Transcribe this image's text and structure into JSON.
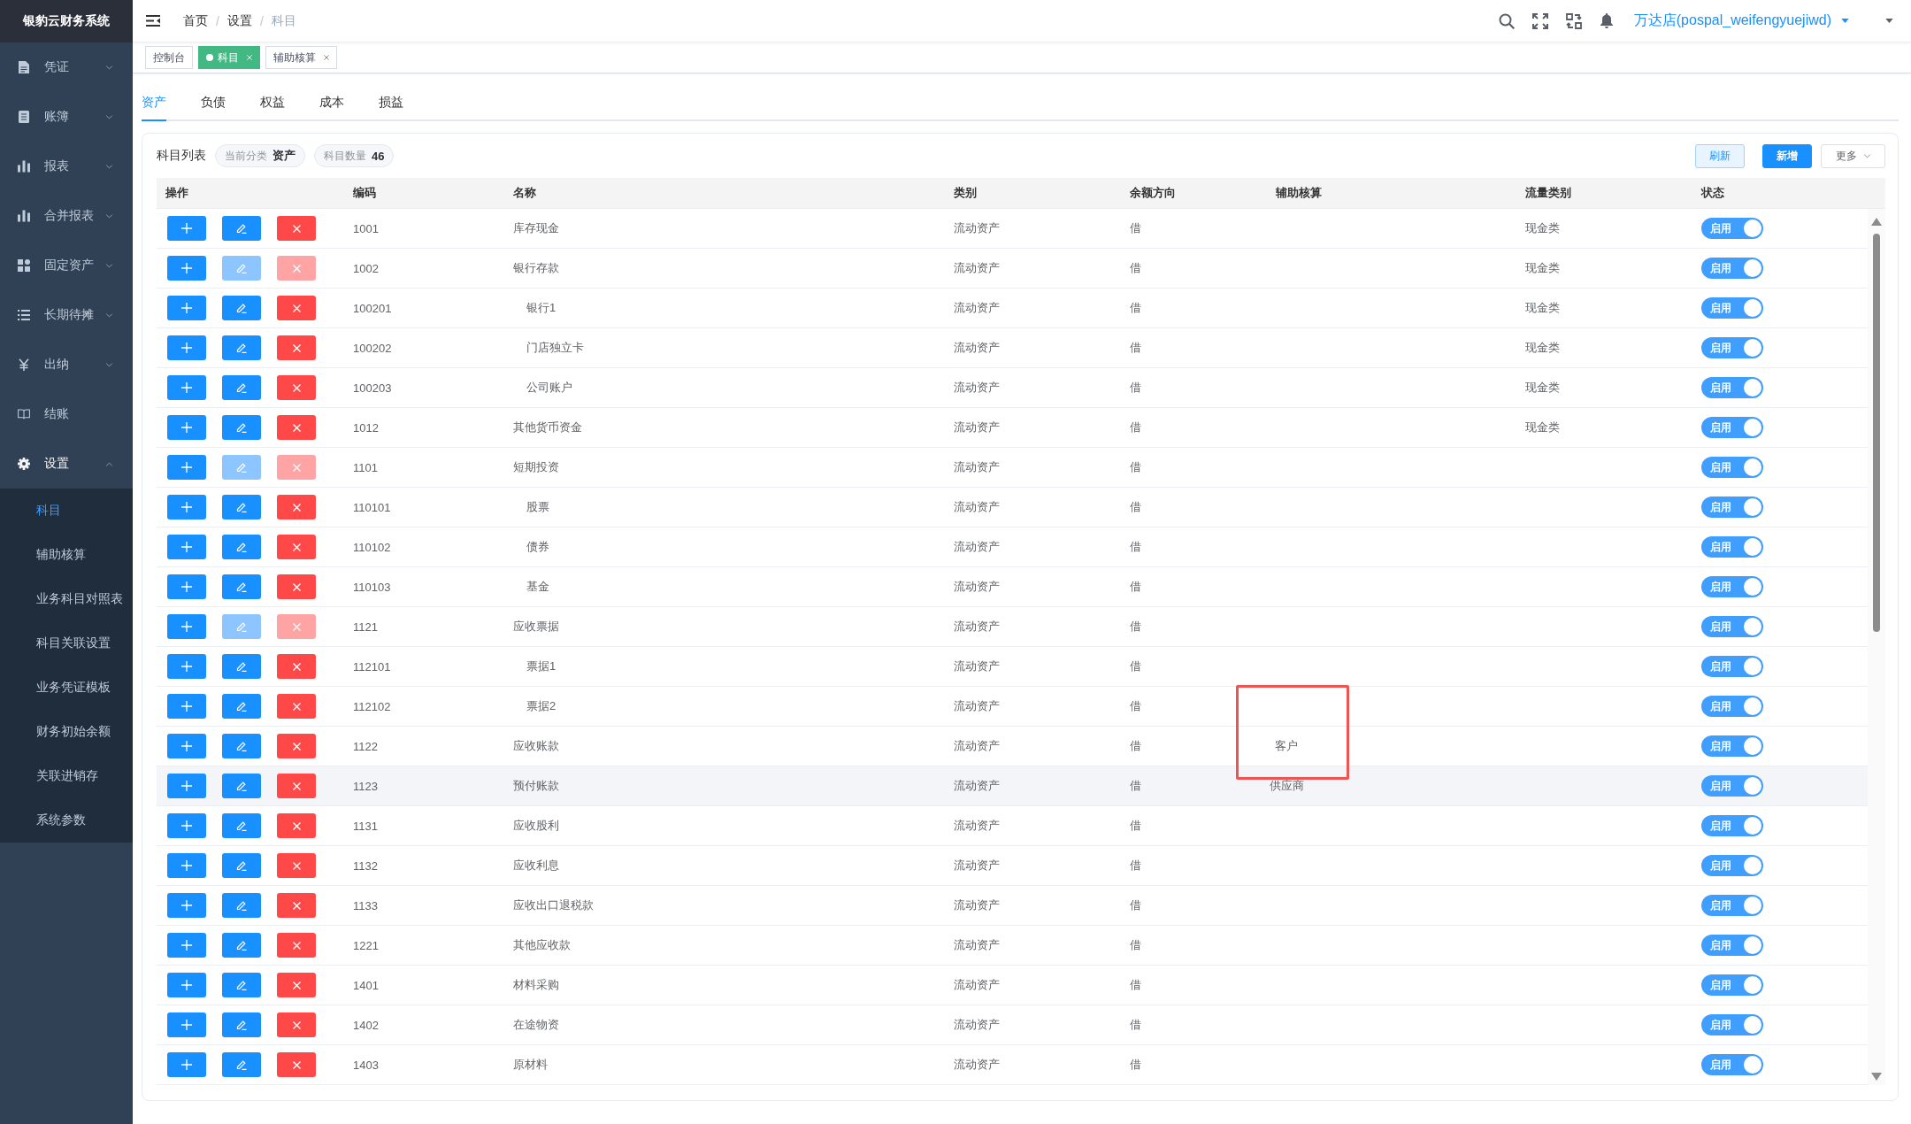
{
  "sidebar": {
    "logo": "银豹云财务系统",
    "items": [
      {
        "label": "凭证",
        "kind": "group",
        "expanded": false
      },
      {
        "label": "账簿",
        "kind": "group",
        "expanded": false
      },
      {
        "label": "报表",
        "kind": "group",
        "expanded": false
      },
      {
        "label": "合并报表",
        "kind": "group",
        "expanded": false
      },
      {
        "label": "固定资产",
        "kind": "group",
        "expanded": false
      },
      {
        "label": "长期待摊",
        "kind": "group",
        "expanded": false
      },
      {
        "label": "出纳",
        "kind": "group",
        "expanded": false
      },
      {
        "label": "结账",
        "kind": "link"
      },
      {
        "label": "设置",
        "kind": "group",
        "expanded": true,
        "children": [
          {
            "label": "科目",
            "selected": true
          },
          {
            "label": "辅助核算",
            "selected": false
          },
          {
            "label": "业务科目对照表",
            "selected": false
          },
          {
            "label": "科目关联设置",
            "selected": false
          },
          {
            "label": "业务凭证模板",
            "selected": false
          },
          {
            "label": "财务初始余额",
            "selected": false
          },
          {
            "label": "关联进销存",
            "selected": false
          },
          {
            "label": "系统参数",
            "selected": false
          }
        ]
      }
    ]
  },
  "header": {
    "breadcrumb": {
      "separator": "/",
      "items": [
        {
          "label": "首页",
          "current": false
        },
        {
          "label": "设置",
          "current": false
        },
        {
          "label": "科目",
          "current": true
        }
      ]
    },
    "user": "万达店(pospal_weifengyuejiwd)"
  },
  "tags": [
    {
      "label": "控制台",
      "selected": false,
      "closable": false
    },
    {
      "label": "科目",
      "selected": true,
      "closable": true
    },
    {
      "label": "辅助核算",
      "selected": false,
      "closable": true
    }
  ],
  "tabs": [
    {
      "label": "资产",
      "selected": true
    },
    {
      "label": "负债",
      "selected": false
    },
    {
      "label": "权益",
      "selected": false
    },
    {
      "label": "成本",
      "selected": false
    },
    {
      "label": "损益",
      "selected": false
    }
  ],
  "panel": {
    "title": "科目列表",
    "chips": [
      {
        "label": "当前分类",
        "value": "资产"
      },
      {
        "label": "科目数量",
        "value": "46"
      }
    ],
    "actions": [
      {
        "label": "刷新",
        "kind": "plain"
      },
      {
        "label": "新增",
        "kind": "primary"
      },
      {
        "label": "更多",
        "kind": "dropdown"
      }
    ]
  },
  "table": {
    "columns": [
      "操作",
      "编码",
      "名称",
      "类别",
      "余额方向",
      "辅助核算",
      "流量类别",
      "状态"
    ],
    "rows": [
      {
        "code": "1001",
        "name": "库存现金",
        "category": "流动资产",
        "balance_direction": "借",
        "cash_flow_type": "现金类",
        "actions_disabled": false,
        "status": "启用",
        "enabled": true,
        "hovered": false
      },
      {
        "code": "1002",
        "name": "银行存款",
        "category": "流动资产",
        "balance_direction": "借",
        "cash_flow_type": "现金类",
        "actions_disabled": true,
        "status": "启用",
        "enabled": true,
        "hovered": false,
        "children": [
          {
            "code": "100201",
            "name": "银行1",
            "category": "流动资产",
            "balance_direction": "借",
            "cash_flow_type": "现金类",
            "actions_disabled": false,
            "status": "启用",
            "enabled": true,
            "hovered": false
          },
          {
            "code": "100202",
            "name": "门店独立卡",
            "category": "流动资产",
            "balance_direction": "借",
            "cash_flow_type": "现金类",
            "actions_disabled": false,
            "status": "启用",
            "enabled": true,
            "hovered": false
          },
          {
            "code": "100203",
            "name": "公司账户",
            "category": "流动资产",
            "balance_direction": "借",
            "cash_flow_type": "现金类",
            "actions_disabled": false,
            "status": "启用",
            "enabled": true,
            "hovered": false
          }
        ]
      },
      {
        "code": "1012",
        "name": "其他货币资金",
        "category": "流动资产",
        "balance_direction": "借",
        "cash_flow_type": "现金类",
        "actions_disabled": false,
        "status": "启用",
        "enabled": true,
        "hovered": false
      },
      {
        "code": "1101",
        "name": "短期投资",
        "category": "流动资产",
        "balance_direction": "借",
        "actions_disabled": true,
        "status": "启用",
        "enabled": true,
        "hovered": false,
        "children": [
          {
            "code": "110101",
            "name": "股票",
            "category": "流动资产",
            "balance_direction": "借",
            "actions_disabled": false,
            "status": "启用",
            "enabled": true,
            "hovered": false
          },
          {
            "code": "110102",
            "name": "债券",
            "category": "流动资产",
            "balance_direction": "借",
            "actions_disabled": false,
            "status": "启用",
            "enabled": true,
            "hovered": false
          },
          {
            "code": "110103",
            "name": "基金",
            "category": "流动资产",
            "balance_direction": "借",
            "actions_disabled": false,
            "status": "启用",
            "enabled": true,
            "hovered": false
          }
        ]
      },
      {
        "code": "1121",
        "name": "应收票据",
        "category": "流动资产",
        "balance_direction": "借",
        "actions_disabled": true,
        "status": "启用",
        "enabled": true,
        "hovered": false,
        "children": [
          {
            "code": "112101",
            "name": "票据1",
            "category": "流动资产",
            "balance_direction": "借",
            "actions_disabled": false,
            "status": "启用",
            "enabled": true,
            "hovered": false
          },
          {
            "code": "112102",
            "name": "票据2",
            "category": "流动资产",
            "balance_direction": "借",
            "actions_disabled": false,
            "status": "启用",
            "enabled": true,
            "hovered": false
          }
        ]
      },
      {
        "code": "1122",
        "name": "应收账款",
        "category": "流动资产",
        "balance_direction": "借",
        "auxiliary": "客户",
        "actions_disabled": false,
        "status": "启用",
        "enabled": true,
        "hovered": false,
        "annotated": true
      },
      {
        "code": "1123",
        "name": "预付账款",
        "category": "流动资产",
        "balance_direction": "借",
        "auxiliary": "供应商",
        "actions_disabled": false,
        "status": "启用",
        "enabled": true,
        "hovered": true
      },
      {
        "code": "1131",
        "name": "应收股利",
        "category": "流动资产",
        "balance_direction": "借",
        "actions_disabled": false,
        "status": "启用",
        "enabled": true,
        "hovered": false
      },
      {
        "code": "1132",
        "name": "应收利息",
        "category": "流动资产",
        "balance_direction": "借",
        "actions_disabled": false,
        "status": "启用",
        "enabled": true,
        "hovered": false
      },
      {
        "code": "1133",
        "name": "应收出口退税款",
        "category": "流动资产",
        "balance_direction": "借",
        "actions_disabled": false,
        "status": "启用",
        "enabled": true,
        "hovered": false
      },
      {
        "code": "1221",
        "name": "其他应收款",
        "category": "流动资产",
        "balance_direction": "借",
        "actions_disabled": false,
        "status": "启用",
        "enabled": true,
        "hovered": false
      },
      {
        "code": "1401",
        "name": "材料采购",
        "category": "流动资产",
        "balance_direction": "借",
        "actions_disabled": false,
        "status": "启用",
        "enabled": true,
        "hovered": false
      },
      {
        "code": "1402",
        "name": "在途物资",
        "category": "流动资产",
        "balance_direction": "借",
        "actions_disabled": false,
        "status": "启用",
        "enabled": true,
        "hovered": false
      },
      {
        "code": "1403",
        "name": "原材料",
        "category": "流动资产",
        "balance_direction": "借",
        "actions_disabled": false,
        "status": "启用",
        "enabled": true,
        "hovered": false
      }
    ]
  }
}
